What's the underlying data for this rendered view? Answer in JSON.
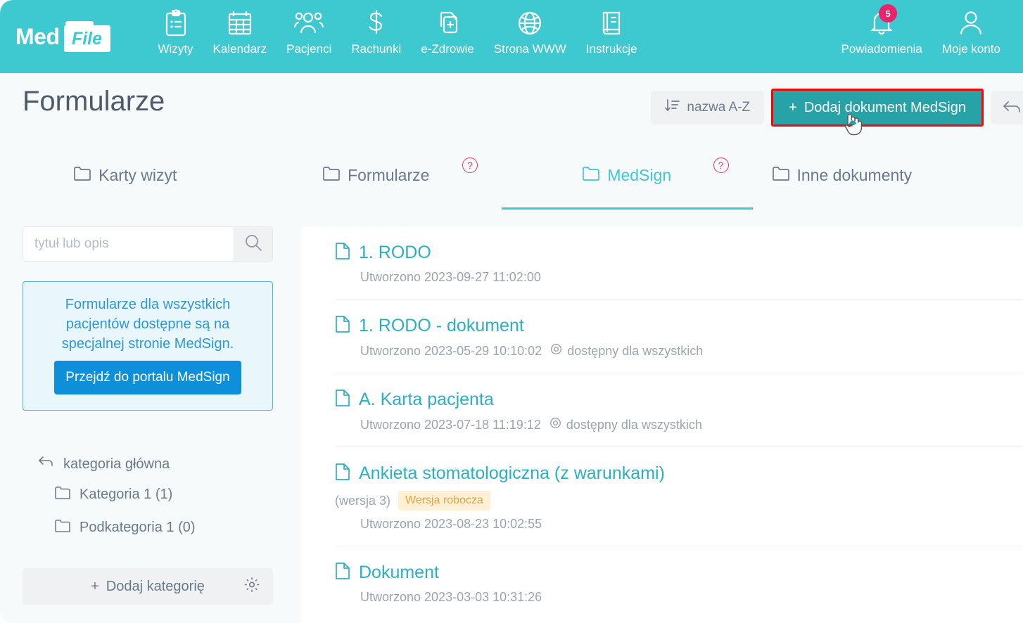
{
  "brand": {
    "med": "Med",
    "file": "File"
  },
  "topnav": {
    "items": [
      {
        "label": "Wizyty",
        "icon": "clipboard-icon"
      },
      {
        "label": "Kalendarz",
        "icon": "calendar-icon"
      },
      {
        "label": "Pacjenci",
        "icon": "patients-icon"
      },
      {
        "label": "Rachunki",
        "icon": "dollar-icon"
      },
      {
        "label": "e-Zdrowie",
        "icon": "ehealth-icon"
      },
      {
        "label": "Strona WWW",
        "icon": "globe-icon"
      },
      {
        "label": "Instrukcje",
        "icon": "book-icon"
      }
    ],
    "right": [
      {
        "label": "Powiadomienia",
        "icon": "bell-icon",
        "badge": "5"
      },
      {
        "label": "Moje konto",
        "icon": "user-icon"
      }
    ]
  },
  "header": {
    "title": "Formularze",
    "sort_label": "nazwa A-Z",
    "add_label": "Dodaj dokument MedSign",
    "add_plus": "+",
    "back_icon": "back-arrow-icon"
  },
  "tabs": [
    {
      "label": "Karty wizyt",
      "active": false,
      "help": false
    },
    {
      "label": "Formularze",
      "active": false,
      "help": true,
      "help_char": "?"
    },
    {
      "label": "MedSign",
      "active": true,
      "help": true,
      "help_char": "?"
    },
    {
      "label": "Inne dokumenty",
      "active": false,
      "help": false
    }
  ],
  "sidebar": {
    "search": {
      "placeholder": "tytuł lub opis",
      "value": "",
      "icon": "search-icon"
    },
    "info": {
      "text": "Formularze dla wszystkich pacjentów dostępne są na specjalnej stronie MedSign.",
      "button": "Przejdź do portalu MedSign"
    },
    "categories": {
      "root": "kategoria główna",
      "items": [
        {
          "label": "Kategoria 1 (1)"
        },
        {
          "label": "Podkategoria 1 (0)"
        }
      ],
      "add_label": "Dodaj kategorię",
      "add_plus": "+",
      "gear_icon": "gear-icon"
    }
  },
  "documents": [
    {
      "title": "1. RODO",
      "created": "Utworzono 2023-09-27 11:02:00",
      "availability": "",
      "version": "",
      "badge": ""
    },
    {
      "title": "1. RODO - dokument",
      "created": "Utworzono 2023-05-29 10:10:02",
      "availability": "dostępny dla wszystkich",
      "version": "",
      "badge": ""
    },
    {
      "title": "A. Karta pacjenta",
      "created": "Utworzono 2023-07-18 11:19:12",
      "availability": "dostępny dla wszystkich",
      "version": "",
      "badge": ""
    },
    {
      "title": "Ankieta stomatologiczna (z warunkami)",
      "created": "Utworzono 2023-08-23 10:02:55",
      "availability": "",
      "version": "(wersja 3)",
      "badge": "Wersja robocza"
    },
    {
      "title": "Dokument",
      "created": "Utworzono 2023-03-03 10:31:26",
      "availability": "",
      "version": "",
      "badge": ""
    }
  ],
  "colors": {
    "brand_teal": "#3ec9d0",
    "accent_button": "#27a3a8",
    "highlight_border": "#ff0000",
    "badge_pink": "#e8246b",
    "link_teal": "#2ab0c5",
    "info_blue": "#2e97dc",
    "draft_orange": "#e8a33d",
    "help_pink": "#f0336b"
  }
}
